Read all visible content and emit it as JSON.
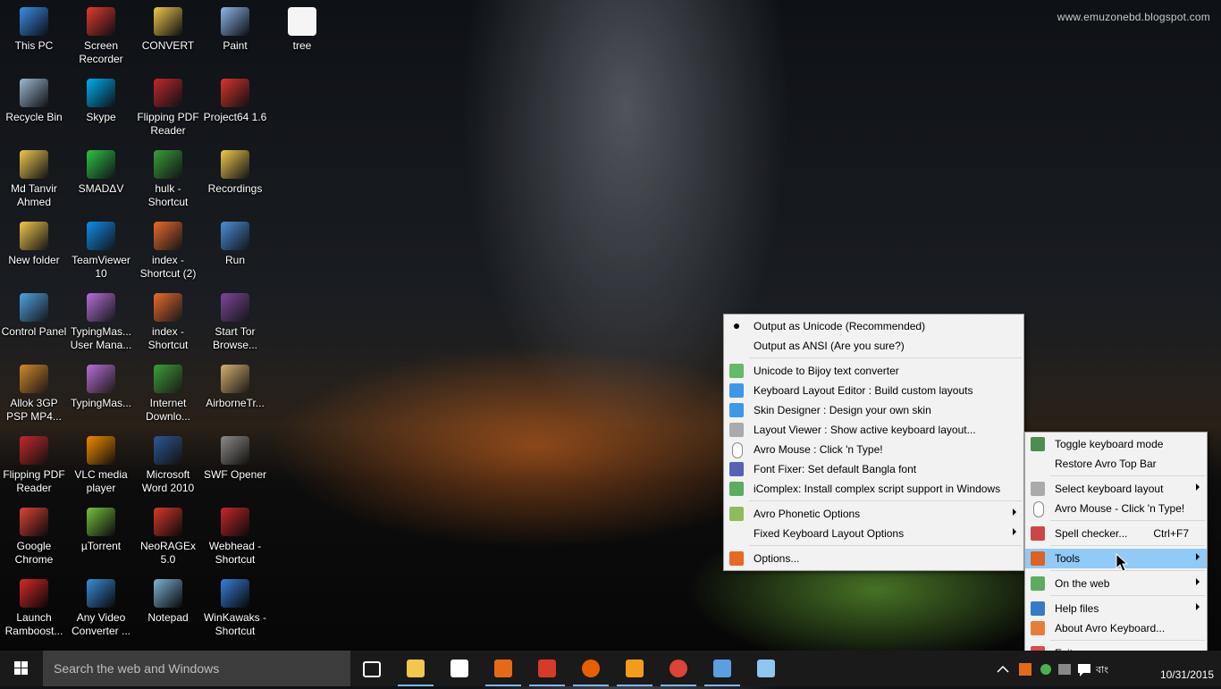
{
  "watermark": "www.emuzonebd.blogspot.com",
  "desktop_icons": [
    {
      "label": "This PC",
      "icon": "computer-icon",
      "color": "#3a8ee6"
    },
    {
      "label": "Screen Recorder",
      "icon": "record-icon",
      "color": "#e23b2e"
    },
    {
      "label": "CONVERT",
      "icon": "folder-icon",
      "color": "#f1c84b"
    },
    {
      "label": "Paint",
      "icon": "paint-icon",
      "color": "#8fb6e9"
    },
    {
      "label": "tree",
      "icon": "file-icon",
      "color": "#f5f5f5"
    },
    {
      "label": "Recycle Bin",
      "icon": "recycle-bin-icon",
      "color": "#9fb8d0"
    },
    {
      "label": "Skype",
      "icon": "skype-icon",
      "color": "#00aff0"
    },
    {
      "label": "Flipping PDF Reader",
      "icon": "pdf-icon",
      "color": "#c0282d"
    },
    {
      "label": "Project64 1.6",
      "icon": "emulator-icon",
      "color": "#d9352a"
    },
    {
      "label": "Md Tanvir Ahmed",
      "icon": "user-folder-icon",
      "color": "#f1c84b"
    },
    {
      "label": "SMADΔV",
      "icon": "antivirus-icon",
      "color": "#2ec445"
    },
    {
      "label": "hulk - Shortcut",
      "icon": "game-icon",
      "color": "#3aa03a"
    },
    {
      "label": "Recordings",
      "icon": "folder-icon",
      "color": "#f1c84b"
    },
    {
      "label": "New folder",
      "icon": "folder-icon",
      "color": "#f1c84b"
    },
    {
      "label": "TeamViewer 10",
      "icon": "teamviewer-icon",
      "color": "#0e8ee9"
    },
    {
      "label": "index - Shortcut (2)",
      "icon": "html-file-icon",
      "color": "#e96b2b"
    },
    {
      "label": "Run",
      "icon": "run-icon",
      "color": "#4a90d9"
    },
    {
      "label": "Control Panel",
      "icon": "control-panel-icon",
      "color": "#4fa3e0"
    },
    {
      "label": "TypingMas... User Mana...",
      "icon": "typing-icon",
      "color": "#b76fd6"
    },
    {
      "label": "index - Shortcut",
      "icon": "html-file-icon",
      "color": "#e96b2b"
    },
    {
      "label": "Start Tor Browse...",
      "icon": "tor-icon",
      "color": "#7d4698"
    },
    {
      "label": "Allok 3GP PSP MP4...",
      "icon": "video-converter-icon",
      "color": "#d08a2a"
    },
    {
      "label": "TypingMas...",
      "icon": "typing-icon",
      "color": "#b76fd6"
    },
    {
      "label": "Internet Downlo...",
      "icon": "download-icon",
      "color": "#3aa03a"
    },
    {
      "label": "AirborneTr...",
      "icon": "eagle-icon",
      "color": "#d4b070"
    },
    {
      "label": "Flipping PDF Reader",
      "icon": "pdf-icon",
      "color": "#c0282d"
    },
    {
      "label": "VLC media player",
      "icon": "vlc-icon",
      "color": "#f08a00"
    },
    {
      "label": "Microsoft Word 2010",
      "icon": "word-icon",
      "color": "#2b5797"
    },
    {
      "label": "SWF Opener",
      "icon": "swf-icon",
      "color": "#8a8a8a"
    },
    {
      "label": "Google Chrome",
      "icon": "chrome-icon",
      "color": "#db4437"
    },
    {
      "label": "µTorrent",
      "icon": "utorrent-icon",
      "color": "#78c043"
    },
    {
      "label": "NeoRAGEx 5.0",
      "icon": "neogeo-icon",
      "color": "#d63a2a"
    },
    {
      "label": "Webhead - Shortcut",
      "icon": "spiderman-icon",
      "color": "#c5282d"
    },
    {
      "label": "Launch Ramboost...",
      "icon": "ramboost-icon",
      "color": "#d62a2a"
    },
    {
      "label": "Any Video Converter ...",
      "icon": "video-converter-icon",
      "color": "#3b8fd8"
    },
    {
      "label": "Notepad",
      "icon": "notepad-icon",
      "color": "#7fb3d5"
    },
    {
      "label": "WinKawaks - Shortcut",
      "icon": "winkawaks-icon",
      "color": "#3a7fd8"
    }
  ],
  "main_menu": {
    "items": [
      {
        "label": "Output as Unicode (Recommended)",
        "icon": "radio-bullet-icon",
        "checked": true
      },
      {
        "label": "Output as ANSI (Are you sure?)",
        "icon": ""
      },
      {
        "label": "Unicode to Bijoy text converter",
        "icon": "converter-icon"
      },
      {
        "label": "Keyboard Layout Editor : Build custom layouts",
        "icon": "keyboard-editor-icon"
      },
      {
        "label": "Skin Designer : Design your own skin",
        "icon": "skin-designer-icon"
      },
      {
        "label": "Layout Viewer : Show active keyboard layout...",
        "icon": "keyboard-icon"
      },
      {
        "label": "Avro Mouse : Click 'n Type!",
        "icon": "mouse-icon"
      },
      {
        "label": "Font Fixer: Set default Bangla font",
        "icon": "font-fixer-icon"
      },
      {
        "label": "iComplex: Install complex script support in Windows",
        "icon": "globe-icon"
      },
      {
        "label": "Avro Phonetic Options",
        "icon": "phonetic-icon",
        "submenu": true
      },
      {
        "label": "Fixed Keyboard Layout Options",
        "icon": "",
        "submenu": true
      },
      {
        "label": "Options...",
        "icon": "tools-icon"
      }
    ]
  },
  "tray_menu": {
    "items": [
      {
        "label": "Toggle keyboard mode",
        "icon": "toggle-icon"
      },
      {
        "label": "Restore Avro Top Bar",
        "icon": ""
      },
      {
        "label": "Select keyboard layout",
        "icon": "keyboard-icon",
        "submenu": true
      },
      {
        "label": "Avro Mouse - Click 'n Type!",
        "icon": "mouse-icon"
      },
      {
        "label": "Spell checker...",
        "icon": "spell-check-icon",
        "shortcut": "Ctrl+F7"
      },
      {
        "label": "Tools",
        "icon": "tools-icon",
        "submenu": true,
        "highlighted": true
      },
      {
        "label": "On the web",
        "icon": "globe-icon",
        "submenu": true
      },
      {
        "label": "Help files",
        "icon": "help-icon",
        "submenu": true
      },
      {
        "label": "About Avro Keyboard...",
        "icon": "avro-icon"
      },
      {
        "label": "Exit",
        "icon": "exit-icon"
      }
    ]
  },
  "taskbar": {
    "search_placeholder": "Search the web and Windows",
    "apps": [
      {
        "name": "task-view",
        "color": "#ffffff"
      },
      {
        "name": "file-explorer",
        "color": "#f1c84b"
      },
      {
        "name": "store",
        "color": "#ffffff"
      },
      {
        "name": "avro-keyboard",
        "color": "#e46a1a"
      },
      {
        "name": "neoragex",
        "color": "#d63a2a"
      },
      {
        "name": "firefox",
        "color": "#e66000"
      },
      {
        "name": "uc-browser",
        "color": "#f29b1c"
      },
      {
        "name": "chrome",
        "color": "#db4437"
      },
      {
        "name": "remote-desktop",
        "color": "#5aa0e0"
      },
      {
        "name": "video-app",
        "color": "#8ec6f0"
      }
    ],
    "clock_date": "10/31/2015"
  }
}
